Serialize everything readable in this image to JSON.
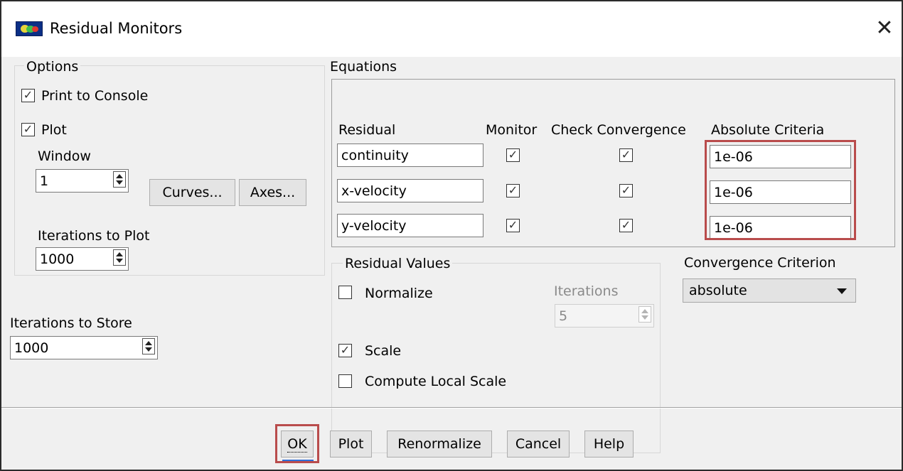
{
  "window": {
    "title": "Residual Monitors",
    "icon": "fluent-app-icon",
    "close_icon": "close-icon"
  },
  "options": {
    "title": "Options",
    "print_to_console": {
      "label": "Print to Console",
      "checked": true
    },
    "plot": {
      "label": "Plot",
      "checked": true
    },
    "window_label": "Window",
    "window_value": "1",
    "curves_label": "Curves...",
    "axes_label": "Axes...",
    "iterations_to_plot_label": "Iterations to Plot",
    "iterations_to_plot_value": "1000"
  },
  "store": {
    "label": "Iterations to Store",
    "value": "1000"
  },
  "equations": {
    "title": "Equations",
    "headers": {
      "residual": "Residual",
      "monitor": "Monitor",
      "check_convergence": "Check Convergence",
      "absolute_criteria": "Absolute Criteria"
    },
    "rows": [
      {
        "name": "continuity",
        "monitor": true,
        "check": true,
        "criteria": "1e-06"
      },
      {
        "name": "x-velocity",
        "monitor": true,
        "check": true,
        "criteria": "1e-06"
      },
      {
        "name": "y-velocity",
        "monitor": true,
        "check": true,
        "criteria": "1e-06"
      }
    ]
  },
  "residual_values": {
    "title": "Residual Values",
    "normalize": {
      "label": "Normalize",
      "checked": false
    },
    "iterations_label": "Iterations",
    "iterations_value": "5",
    "scale": {
      "label": "Scale",
      "checked": true
    },
    "compute_local_scale": {
      "label": "Compute Local Scale",
      "checked": false
    }
  },
  "convergence": {
    "label": "Convergence Criterion",
    "selected": "absolute"
  },
  "buttons": {
    "ok": "OK",
    "plot": "Plot",
    "renormalize": "Renormalize",
    "cancel": "Cancel",
    "help": "Help"
  },
  "check_glyph": "✓",
  "colors": {
    "highlight": "#b94c4c",
    "focus_underline": "#2f6fd8",
    "title_bar": "#ffffff",
    "dialog_bg": "#f0f0f0"
  }
}
